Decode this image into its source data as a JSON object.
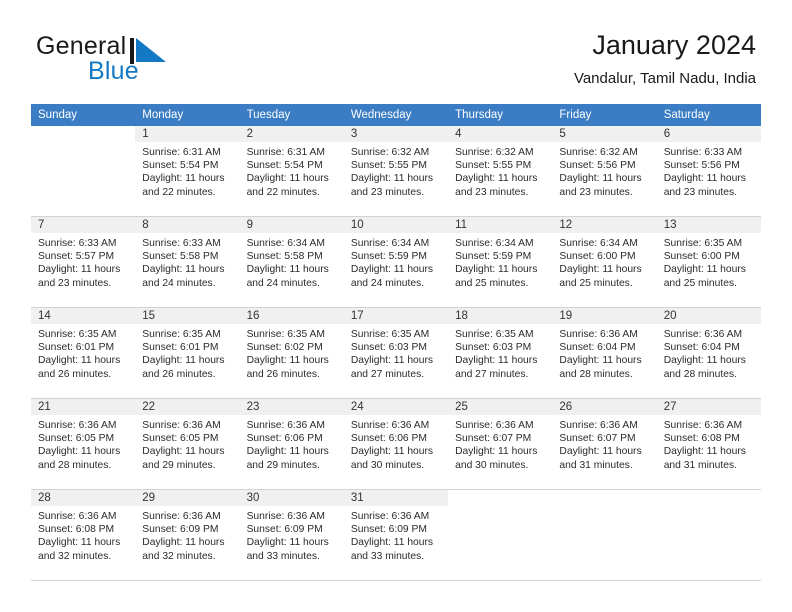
{
  "brand": {
    "name_part1": "General",
    "name_part2": "Blue",
    "logo_color": "#1479c4",
    "mark_icon": "triangle-flag-icon"
  },
  "header": {
    "title": "January 2024",
    "subtitle": "Vandalur, Tamil Nadu, India"
  },
  "calendar": {
    "header_bg": "#3b7dc4",
    "daynum_bg": "#f0f0f0",
    "weekday_headers": [
      "Sunday",
      "Monday",
      "Tuesday",
      "Wednesday",
      "Thursday",
      "Friday",
      "Saturday"
    ],
    "weeks": [
      [
        {
          "day": "",
          "sunrise": "",
          "sunset": "",
          "daylight1": "",
          "daylight2": "",
          "blank": true
        },
        {
          "day": "1",
          "sunrise": "Sunrise: 6:31 AM",
          "sunset": "Sunset: 5:54 PM",
          "daylight1": "Daylight: 11 hours",
          "daylight2": "and 22 minutes."
        },
        {
          "day": "2",
          "sunrise": "Sunrise: 6:31 AM",
          "sunset": "Sunset: 5:54 PM",
          "daylight1": "Daylight: 11 hours",
          "daylight2": "and 22 minutes."
        },
        {
          "day": "3",
          "sunrise": "Sunrise: 6:32 AM",
          "sunset": "Sunset: 5:55 PM",
          "daylight1": "Daylight: 11 hours",
          "daylight2": "and 23 minutes."
        },
        {
          "day": "4",
          "sunrise": "Sunrise: 6:32 AM",
          "sunset": "Sunset: 5:55 PM",
          "daylight1": "Daylight: 11 hours",
          "daylight2": "and 23 minutes."
        },
        {
          "day": "5",
          "sunrise": "Sunrise: 6:32 AM",
          "sunset": "Sunset: 5:56 PM",
          "daylight1": "Daylight: 11 hours",
          "daylight2": "and 23 minutes."
        },
        {
          "day": "6",
          "sunrise": "Sunrise: 6:33 AM",
          "sunset": "Sunset: 5:56 PM",
          "daylight1": "Daylight: 11 hours",
          "daylight2": "and 23 minutes."
        }
      ],
      [
        {
          "day": "7",
          "sunrise": "Sunrise: 6:33 AM",
          "sunset": "Sunset: 5:57 PM",
          "daylight1": "Daylight: 11 hours",
          "daylight2": "and 23 minutes."
        },
        {
          "day": "8",
          "sunrise": "Sunrise: 6:33 AM",
          "sunset": "Sunset: 5:58 PM",
          "daylight1": "Daylight: 11 hours",
          "daylight2": "and 24 minutes."
        },
        {
          "day": "9",
          "sunrise": "Sunrise: 6:34 AM",
          "sunset": "Sunset: 5:58 PM",
          "daylight1": "Daylight: 11 hours",
          "daylight2": "and 24 minutes."
        },
        {
          "day": "10",
          "sunrise": "Sunrise: 6:34 AM",
          "sunset": "Sunset: 5:59 PM",
          "daylight1": "Daylight: 11 hours",
          "daylight2": "and 24 minutes."
        },
        {
          "day": "11",
          "sunrise": "Sunrise: 6:34 AM",
          "sunset": "Sunset: 5:59 PM",
          "daylight1": "Daylight: 11 hours",
          "daylight2": "and 25 minutes."
        },
        {
          "day": "12",
          "sunrise": "Sunrise: 6:34 AM",
          "sunset": "Sunset: 6:00 PM",
          "daylight1": "Daylight: 11 hours",
          "daylight2": "and 25 minutes."
        },
        {
          "day": "13",
          "sunrise": "Sunrise: 6:35 AM",
          "sunset": "Sunset: 6:00 PM",
          "daylight1": "Daylight: 11 hours",
          "daylight2": "and 25 minutes."
        }
      ],
      [
        {
          "day": "14",
          "sunrise": "Sunrise: 6:35 AM",
          "sunset": "Sunset: 6:01 PM",
          "daylight1": "Daylight: 11 hours",
          "daylight2": "and 26 minutes."
        },
        {
          "day": "15",
          "sunrise": "Sunrise: 6:35 AM",
          "sunset": "Sunset: 6:01 PM",
          "daylight1": "Daylight: 11 hours",
          "daylight2": "and 26 minutes."
        },
        {
          "day": "16",
          "sunrise": "Sunrise: 6:35 AM",
          "sunset": "Sunset: 6:02 PM",
          "daylight1": "Daylight: 11 hours",
          "daylight2": "and 26 minutes."
        },
        {
          "day": "17",
          "sunrise": "Sunrise: 6:35 AM",
          "sunset": "Sunset: 6:03 PM",
          "daylight1": "Daylight: 11 hours",
          "daylight2": "and 27 minutes."
        },
        {
          "day": "18",
          "sunrise": "Sunrise: 6:35 AM",
          "sunset": "Sunset: 6:03 PM",
          "daylight1": "Daylight: 11 hours",
          "daylight2": "and 27 minutes."
        },
        {
          "day": "19",
          "sunrise": "Sunrise: 6:36 AM",
          "sunset": "Sunset: 6:04 PM",
          "daylight1": "Daylight: 11 hours",
          "daylight2": "and 28 minutes."
        },
        {
          "day": "20",
          "sunrise": "Sunrise: 6:36 AM",
          "sunset": "Sunset: 6:04 PM",
          "daylight1": "Daylight: 11 hours",
          "daylight2": "and 28 minutes."
        }
      ],
      [
        {
          "day": "21",
          "sunrise": "Sunrise: 6:36 AM",
          "sunset": "Sunset: 6:05 PM",
          "daylight1": "Daylight: 11 hours",
          "daylight2": "and 28 minutes."
        },
        {
          "day": "22",
          "sunrise": "Sunrise: 6:36 AM",
          "sunset": "Sunset: 6:05 PM",
          "daylight1": "Daylight: 11 hours",
          "daylight2": "and 29 minutes."
        },
        {
          "day": "23",
          "sunrise": "Sunrise: 6:36 AM",
          "sunset": "Sunset: 6:06 PM",
          "daylight1": "Daylight: 11 hours",
          "daylight2": "and 29 minutes."
        },
        {
          "day": "24",
          "sunrise": "Sunrise: 6:36 AM",
          "sunset": "Sunset: 6:06 PM",
          "daylight1": "Daylight: 11 hours",
          "daylight2": "and 30 minutes."
        },
        {
          "day": "25",
          "sunrise": "Sunrise: 6:36 AM",
          "sunset": "Sunset: 6:07 PM",
          "daylight1": "Daylight: 11 hours",
          "daylight2": "and 30 minutes."
        },
        {
          "day": "26",
          "sunrise": "Sunrise: 6:36 AM",
          "sunset": "Sunset: 6:07 PM",
          "daylight1": "Daylight: 11 hours",
          "daylight2": "and 31 minutes."
        },
        {
          "day": "27",
          "sunrise": "Sunrise: 6:36 AM",
          "sunset": "Sunset: 6:08 PM",
          "daylight1": "Daylight: 11 hours",
          "daylight2": "and 31 minutes."
        }
      ],
      [
        {
          "day": "28",
          "sunrise": "Sunrise: 6:36 AM",
          "sunset": "Sunset: 6:08 PM",
          "daylight1": "Daylight: 11 hours",
          "daylight2": "and 32 minutes."
        },
        {
          "day": "29",
          "sunrise": "Sunrise: 6:36 AM",
          "sunset": "Sunset: 6:09 PM",
          "daylight1": "Daylight: 11 hours",
          "daylight2": "and 32 minutes."
        },
        {
          "day": "30",
          "sunrise": "Sunrise: 6:36 AM",
          "sunset": "Sunset: 6:09 PM",
          "daylight1": "Daylight: 11 hours",
          "daylight2": "and 33 minutes."
        },
        {
          "day": "31",
          "sunrise": "Sunrise: 6:36 AM",
          "sunset": "Sunset: 6:09 PM",
          "daylight1": "Daylight: 11 hours",
          "daylight2": "and 33 minutes."
        },
        {
          "day": "",
          "sunrise": "",
          "sunset": "",
          "daylight1": "",
          "daylight2": "",
          "blank": true
        },
        {
          "day": "",
          "sunrise": "",
          "sunset": "",
          "daylight1": "",
          "daylight2": "",
          "blank": true
        },
        {
          "day": "",
          "sunrise": "",
          "sunset": "",
          "daylight1": "",
          "daylight2": "",
          "blank": true
        }
      ]
    ]
  }
}
